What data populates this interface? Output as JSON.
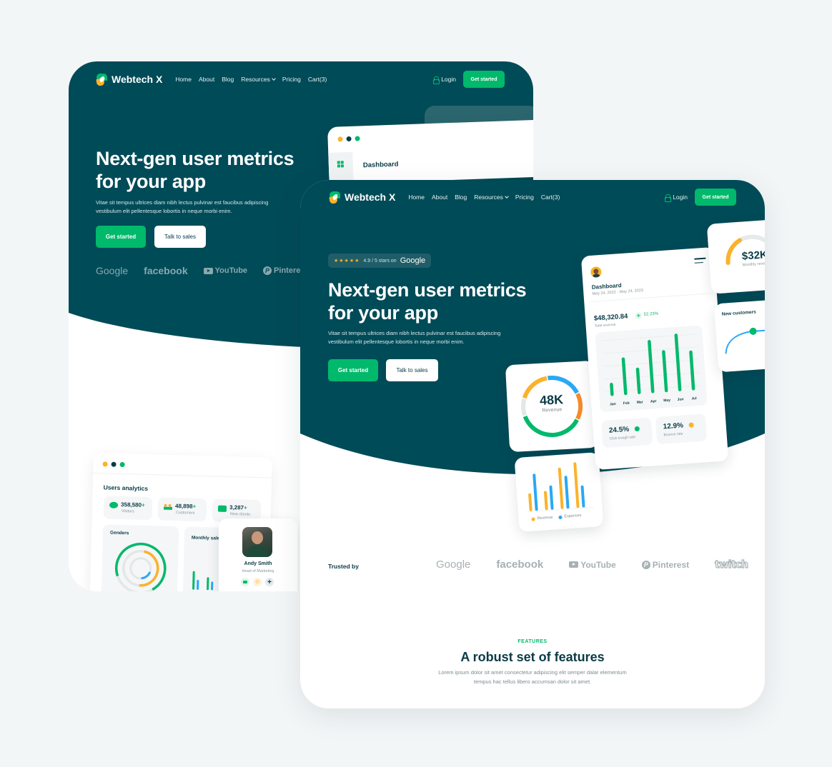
{
  "colors": {
    "primary_teal": "#004b58",
    "accent_green": "#00b96b",
    "accent_yellow": "#fbb22b",
    "accent_blue": "#2aa8f5",
    "accent_orange": "#f58a2a"
  },
  "back_page": {
    "nav": {
      "brand": "Webtech X",
      "links": [
        "Home",
        "About",
        "Blog",
        "Resources",
        "Pricing",
        "Cart(3)"
      ],
      "login": "Login",
      "cta": "Get started"
    },
    "hero": {
      "title_line1": "Next-gen user metrics",
      "title_line2": "for your app",
      "subtitle_line1": "Vitae sit tempus ultrices diam nibh lectus pulvinar est faucibus adipiscing",
      "subtitle_line2": "vestibulum elit pellentesque lobortis in neque morbi enim.",
      "primary_button": "Get started",
      "secondary_button": "Talk to sales"
    },
    "brands": [
      "Google",
      "facebook",
      "YouTube",
      "Pinterest"
    ],
    "dashboard_preview": {
      "title": "Dashboard"
    },
    "analytics_preview": {
      "title": "Users analytics",
      "stats": [
        {
          "value": "358,580",
          "suffix": "+",
          "label": "Visitors",
          "icon": "eye-icon"
        },
        {
          "value": "48,898",
          "suffix": "+",
          "label": "Customers",
          "icon": "users-icon"
        },
        {
          "value": "3,287",
          "suffix": "+",
          "label": "New clients",
          "icon": "wallet-icon"
        }
      ],
      "genders_title": "Genders",
      "genders_rings": {
        "outer_green": 0.72,
        "middle_yellow": 0.48,
        "inner_blue": 0.18
      },
      "monthly_sales_title": "Monthly sales",
      "profile": {
        "name": "Andy Smith",
        "role": "Head of Marketing",
        "actions": [
          "mail-icon",
          "phone-icon",
          "plus-icon"
        ]
      }
    }
  },
  "front_page": {
    "nav": {
      "brand": "Webtech X",
      "links": [
        "Home",
        "About",
        "Blog",
        "Resources",
        "Pricing",
        "Cart(3)"
      ],
      "login": "Login",
      "cta": "Get started"
    },
    "rating_badge": {
      "stars": 5,
      "text": "4.9 / 5 stars on",
      "brand": "Google"
    },
    "hero": {
      "title_line1": "Next-gen user metrics",
      "title_line2": "for your app",
      "subtitle_line1": "Vitae sit tempus ultrices diam nibh lectus pulvinar est faucibus adipiscing",
      "subtitle_line2": "vestibulum elit pellentesque lobortis in neque morbi enim.",
      "primary_button": "Get started",
      "secondary_button": "Talk to sales"
    },
    "revenue_donut": {
      "value": "48K",
      "label": "Revenue",
      "segments": [
        {
          "color": "#fbb22b",
          "fraction": 0.18
        },
        {
          "color": "#2aa8f5",
          "fraction": 0.2
        },
        {
          "color": "#f58a2a",
          "fraction": 0.15
        },
        {
          "color": "#00b96b",
          "fraction": 0.37
        },
        {
          "color": "#e3e7e8",
          "fraction": 0.1
        }
      ]
    },
    "revenue_expenses_chart": {
      "legend": [
        "Revenue",
        "Expenses"
      ],
      "groups": [
        {
          "revenue": 35,
          "expenses": 80
        },
        {
          "revenue": 38,
          "expenses": 50
        },
        {
          "revenue": 90,
          "expenses": 70
        },
        {
          "revenue": 100,
          "expenses": 45
        }
      ]
    },
    "dashboard_card": {
      "title": "Dashboard",
      "date_range": "May 24, 2022 - May 24, 2023",
      "total_revenue": "$48,320.84",
      "growth": "52.23%",
      "total_revenue_label": "Total revenue",
      "months": [
        "Jan",
        "Feb",
        "Mar",
        "Apr",
        "May",
        "Jun",
        "Jul"
      ],
      "values": [
        18,
        62,
        42,
        90,
        70,
        98,
        66
      ],
      "click_rate": "24.5%",
      "click_rate_label": "Click trough rate",
      "bounce_rate": "12.9%",
      "bounce_rate_label": "Bounce rate"
    },
    "monthly_revenue_card": {
      "value": "$32K",
      "label": "Monthly revenue",
      "progress": 0.35
    },
    "new_customers_card": {
      "title": "New customers"
    },
    "trusted": {
      "label": "Trusted by",
      "logos": [
        "Google",
        "facebook",
        "YouTube",
        "Pinterest",
        "twitch"
      ]
    },
    "features": {
      "eyebrow": "FEATURES",
      "title": "A robust set of features",
      "subtitle_line1": "Lorem ipsum dolor sit amet consectetur adipiscing elit semper dalar elementum",
      "subtitle_line2": "tempus hac tellus libero accumsan dolor sit amet."
    }
  }
}
